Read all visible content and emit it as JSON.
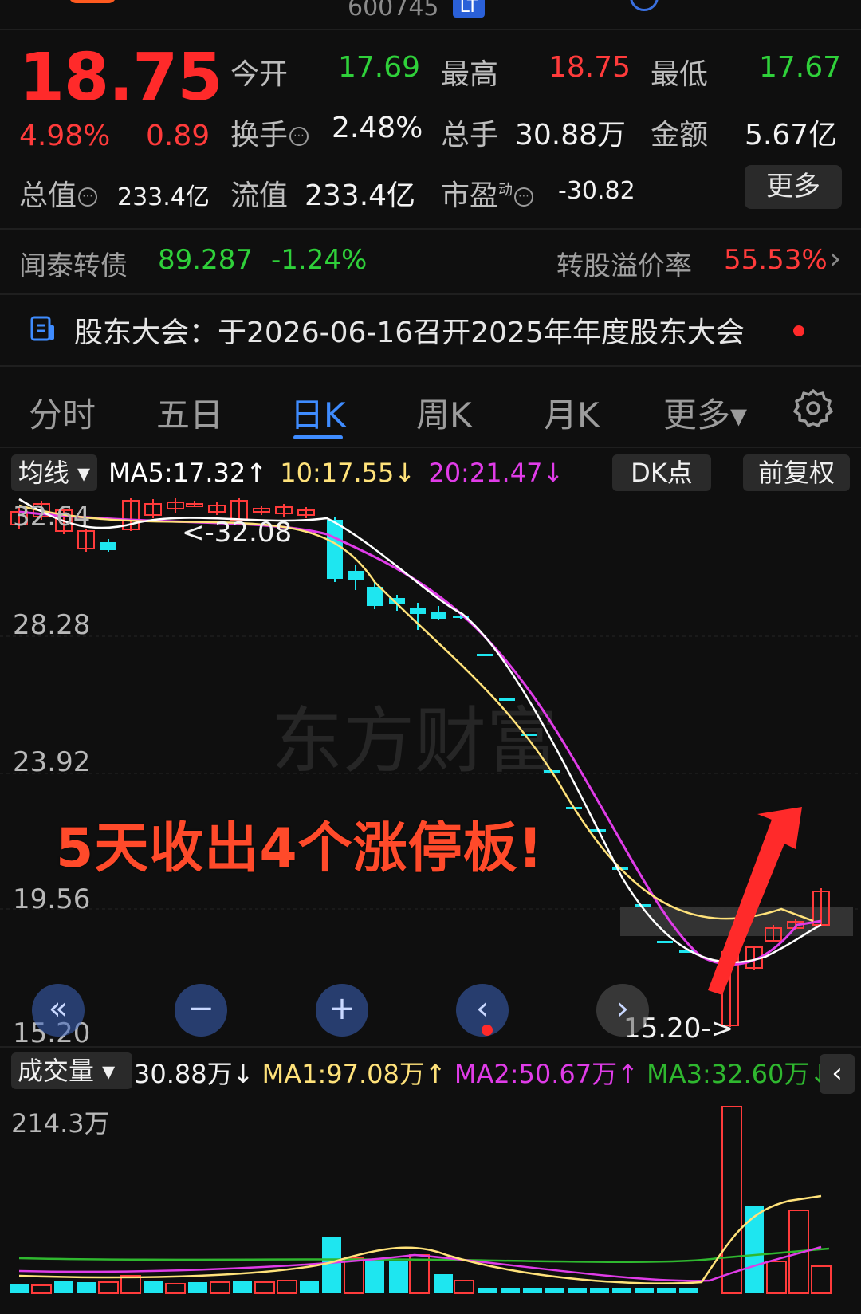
{
  "header": {
    "stock_code": "600745",
    "code_badge": "LT"
  },
  "quote": {
    "price": "18.75",
    "change_pct": "4.98%",
    "change_amt": "0.89",
    "open_label": "今开",
    "open_value": "17.69",
    "high_label": "最高",
    "high_value": "18.75",
    "low_label": "最低",
    "low_value": "17.67",
    "turnover_label": "换手",
    "turnover_value": "2.48%",
    "volume_label": "总手",
    "volume_value": "30.88万",
    "amount_label": "金额",
    "amount_value": "5.67亿",
    "mktcap_label": "总值",
    "mktcap_value": "233.4亿",
    "float_label": "流值",
    "float_value": "233.4亿",
    "pe_label": "市盈",
    "pe_sup": "动",
    "pe_value": "-30.82",
    "info_glyph": "⋯",
    "more_label": "更多"
  },
  "bond": {
    "name": "闻泰转债",
    "price": "89.287",
    "change": "-1.24%",
    "premium_label": "转股溢价率",
    "premium_value": "55.53%",
    "arrow": "›"
  },
  "notice": {
    "text": "股东大会：于2026-06-16召开2025年年度股东大会"
  },
  "tabs": [
    {
      "label": "分时"
    },
    {
      "label": "五日"
    },
    {
      "label": "日K"
    },
    {
      "label": "周K"
    },
    {
      "label": "月K"
    },
    {
      "label": "更多▾"
    }
  ],
  "indicator": {
    "selector": "均线 ▾",
    "ma5": "MA5:17.32↑",
    "ma10": "10:17.55↓",
    "ma20": "20:21.47↓",
    "dk_label": "DK点",
    "adjust_label": "前复权"
  },
  "chart": {
    "y_labels": [
      "32.64",
      "28.28",
      "23.92",
      "19.56",
      "15.20"
    ],
    "hi_marker": "<-32.08",
    "lo_marker": "15.20->",
    "annotation": "5天收出4个涨停板!",
    "watermark": "东方财富"
  },
  "volume": {
    "selector": "成交量 ▾",
    "current": "30.88万↓",
    "ma1": "MA1:97.08万↑",
    "ma2": "MA2:50.67万↑",
    "ma3": "MA3:32.60万↓",
    "max_label": "214.3万",
    "back_btn": "‹"
  },
  "nav": {
    "rewind": "«",
    "zoom_out": "−",
    "zoom_in": "+",
    "prev": "‹",
    "next": "›"
  },
  "colors": {
    "up": "#ff3b3b",
    "down": "#1ee6f0",
    "ma5": "#ffffff",
    "ma10": "#ffe27a",
    "ma20": "#e03ce8",
    "accent": "#3f8cff",
    "vol_ma3": "#2fb82f"
  }
}
